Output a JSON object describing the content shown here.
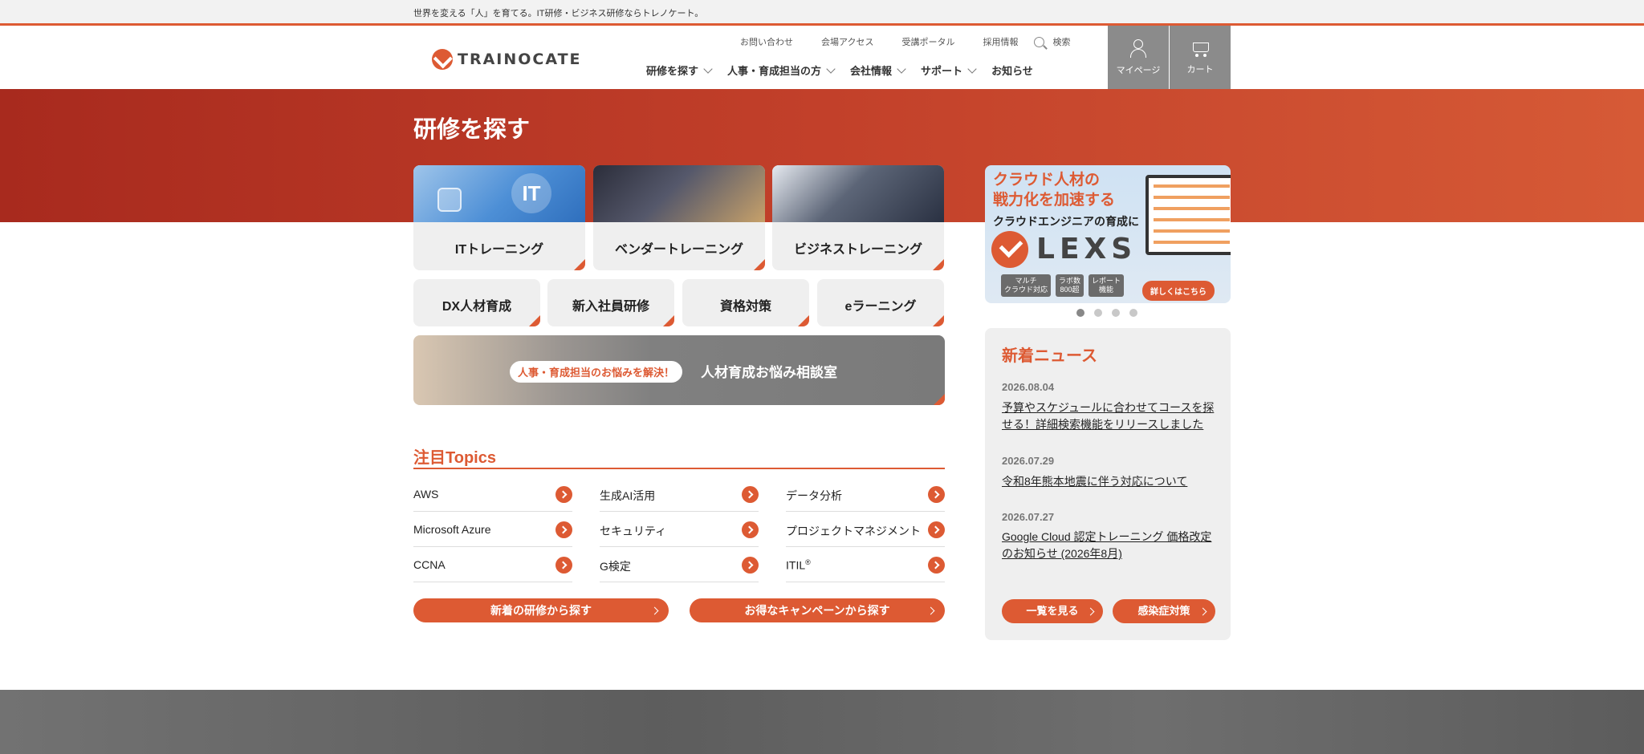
{
  "topbar": {
    "tagline": "世界を変える「人」を育てる。IT研修・ビジネス研修ならトレノケート。"
  },
  "header": {
    "logo_text": "TRAINOCATE",
    "util_links": [
      "お問い合わせ",
      "会場アクセス",
      "受講ポータル",
      "採用情報"
    ],
    "search_label": "検索",
    "nav": [
      "研修を探す",
      "人事・育成担当の方",
      "会社情報",
      "サポート",
      "お知らせ"
    ],
    "mypage_label": "マイページ",
    "cart_label": "カート"
  },
  "hero": {
    "title": "研修を探す"
  },
  "cards": {
    "row1": [
      "ITトレーニング",
      "ベンダートレーニング",
      "ビジネストレーニング"
    ],
    "row2": [
      "DX人材育成",
      "新入社員研修",
      "資格対策",
      "eラーニング"
    ],
    "it_badge": "IT"
  },
  "promo": {
    "pill": "人事・育成担当のお悩みを解決！",
    "title": "人材育成お悩み相談室"
  },
  "topics": {
    "title": "注目Topics",
    "items": [
      "AWS",
      "生成AI活用",
      "データ分析",
      "Microsoft Azure",
      "セキュリティ",
      "プロジェクトマネジメント",
      "CCNA",
      "G検定",
      "ITIL"
    ],
    "itil_reg": "®",
    "btn_new": "新着の研修から探す",
    "btn_campaign": "お得なキャンペーンから探す"
  },
  "lexs": {
    "heading_line1": "クラウド人材の",
    "heading_line2": "戦力化を加速する",
    "subheading": "クラウドエンジニアの育成に",
    "logo": "LEXS",
    "tags": [
      "マルチ\nクラウド対応",
      "ラボ数\n800超",
      "レポート\n機能"
    ],
    "more": "詳しくはこちら"
  },
  "carousel": {
    "count": 4,
    "active": 0
  },
  "news": {
    "title": "新着ニュース",
    "items": [
      {
        "date": "2026.08.04",
        "text": "予算やスケジュールに合わせてコースを探せる！詳細検索機能をリリースしました"
      },
      {
        "date": "2026.07.29",
        "text": "令和8年熊本地震に伴う対応について"
      },
      {
        "date": "2026.07.27",
        "text": "Google Cloud 認定トレーニング 価格改定のお知らせ (2026年8月)"
      }
    ],
    "btn_list": "一覧を見る",
    "btn_infection": "感染症対策"
  },
  "colors": {
    "accent": "#dd5a33",
    "band_dark": "#a82a1e",
    "header_btn": "#8b8b8b"
  }
}
